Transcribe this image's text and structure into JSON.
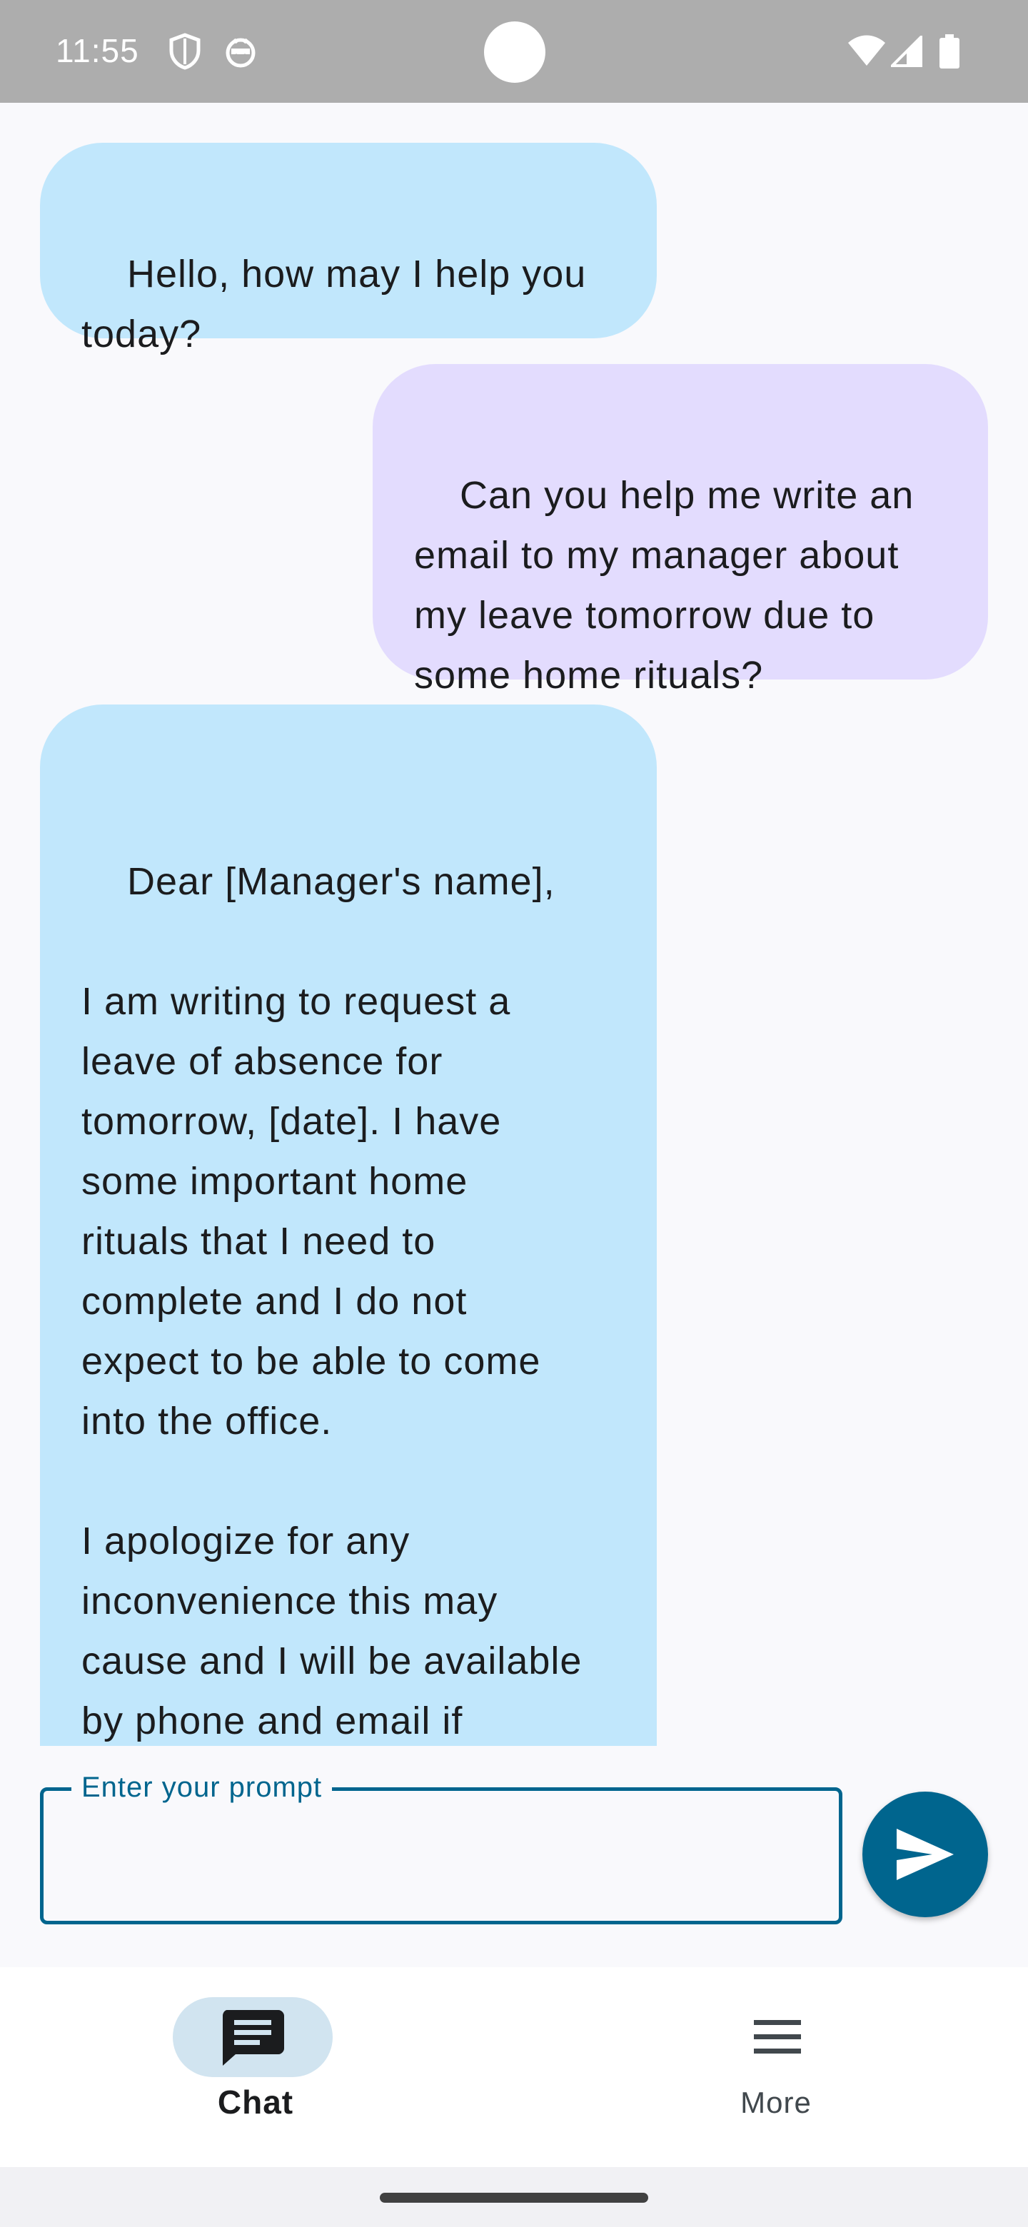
{
  "status_bar": {
    "time": "11:55",
    "icons": [
      "shield-icon",
      "android-face-icon",
      "wifi-icon",
      "signal-icon",
      "battery-icon"
    ],
    "background": "#adadad"
  },
  "messages": [
    {
      "role": "model",
      "text": "Hello, how may I help you\ntoday?"
    },
    {
      "role": "user",
      "text": "Can you help me write an\nemail to my manager about\nmy leave tomorrow due to\nsome home rituals?"
    },
    {
      "role": "model",
      "text": "Dear [Manager's name],\n\nI am writing to request a\nleave of absence for\ntomorrow, [date]. I have\nsome important home\nrituals that I need to\ncomplete and I do not\nexpect to be able to come\ninto the office.\n\nI apologize for any\ninconvenience this may\ncause and I will be available\nby phone and email if\nneeded."
    }
  ],
  "prompt": {
    "label": "Enter your prompt",
    "value": ""
  },
  "send_button": {
    "icon": "send-icon",
    "color": "#00658e"
  },
  "bottom_nav": {
    "items": [
      {
        "label": "Chat",
        "icon": "chat-icon",
        "active": true
      },
      {
        "label": "More",
        "icon": "menu-icon",
        "active": false
      }
    ]
  },
  "colors": {
    "model_bubble": "#c1e7fc",
    "user_bubble": "#e3dcfe",
    "accent": "#00658e",
    "active_nav_pill": "#d1e4f0"
  }
}
